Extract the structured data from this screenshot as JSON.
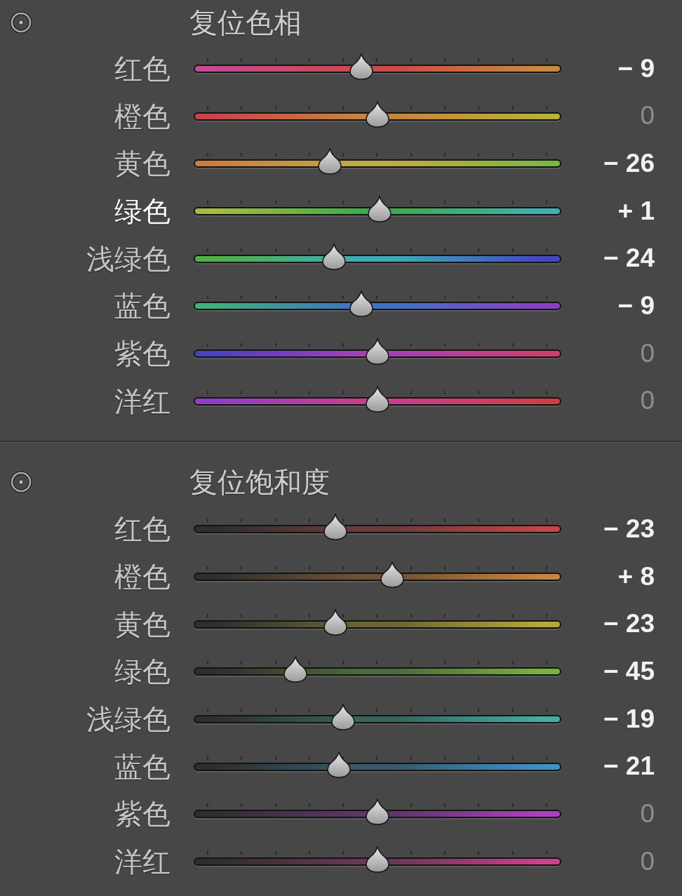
{
  "sections": [
    {
      "title": "复位色相",
      "rows": [
        {
          "label": "红色",
          "highlighted": false,
          "stops": [
            {
              "color": "#c44a92"
            },
            {
              "color": "#cc4a4a"
            },
            {
              "color": "#c98a3e"
            }
          ],
          "level": 0.455,
          "value": "− 9",
          "dimmed": false
        },
        {
          "label": "橙色",
          "highlighted": false,
          "stops": [
            {
              "color": "#c8444a"
            },
            {
              "color": "#c8843e"
            },
            {
              "color": "#b8b03c"
            }
          ],
          "level": 0.5,
          "value": "0",
          "dimmed": true
        },
        {
          "label": "黄色",
          "highlighted": false,
          "stops": [
            {
              "color": "#cc7c3e"
            },
            {
              "color": "#c0ac3e"
            },
            {
              "color": "#7cb83e"
            }
          ],
          "level": 0.37,
          "value": "− 26",
          "dimmed": false
        },
        {
          "label": "绿色",
          "highlighted": true,
          "stops": [
            {
              "color": "#a6bc3e"
            },
            {
              "color": "#3eac4a"
            },
            {
              "color": "#3eb0b4"
            }
          ],
          "level": 0.505,
          "value": "+ 1",
          "dimmed": false
        },
        {
          "label": "浅绿色",
          "highlighted": false,
          "stops": [
            {
              "color": "#52b046"
            },
            {
              "color": "#3eaab4"
            },
            {
              "color": "#4446c4"
            }
          ],
          "level": 0.38,
          "value": "− 24",
          "dimmed": false
        },
        {
          "label": "蓝色",
          "highlighted": false,
          "stops": [
            {
              "color": "#3eb07c"
            },
            {
              "color": "#3e72c4"
            },
            {
              "color": "#8a3ec8"
            }
          ],
          "level": 0.455,
          "value": "− 9",
          "dimmed": false
        },
        {
          "label": "紫色",
          "highlighted": false,
          "stops": [
            {
              "color": "#4a40c4"
            },
            {
              "color": "#a63eb8"
            },
            {
              "color": "#d03e6e"
            }
          ],
          "level": 0.5,
          "value": "0",
          "dimmed": true
        },
        {
          "label": "洋红",
          "highlighted": false,
          "stops": [
            {
              "color": "#8e3ec8"
            },
            {
              "color": "#c83e8e"
            },
            {
              "color": "#d03e44"
            }
          ],
          "level": 0.5,
          "value": "0",
          "dimmed": true
        }
      ]
    },
    {
      "title": "复位饱和度",
      "rows": [
        {
          "label": "红色",
          "highlighted": false,
          "stops": [
            {
              "color": "#2e2e2e"
            },
            {
              "color": "#6e3a3a"
            },
            {
              "color": "#c84444"
            }
          ],
          "level": 0.385,
          "value": "− 23",
          "dimmed": false
        },
        {
          "label": "橙色",
          "highlighted": false,
          "stops": [
            {
              "color": "#2e2e2e"
            },
            {
              "color": "#6e5236"
            },
            {
              "color": "#c8843e"
            }
          ],
          "level": 0.54,
          "value": "+ 8",
          "dimmed": false
        },
        {
          "label": "黄色",
          "highlighted": false,
          "stops": [
            {
              "color": "#2e2e2e"
            },
            {
              "color": "#6a6436"
            },
            {
              "color": "#b8a83c"
            }
          ],
          "level": 0.385,
          "value": "− 23",
          "dimmed": false
        },
        {
          "label": "绿色",
          "highlighted": false,
          "stops": [
            {
              "color": "#2e2e2e"
            },
            {
              "color": "#4e6a36"
            },
            {
              "color": "#78b43e"
            }
          ],
          "level": 0.275,
          "value": "− 45",
          "dimmed": false
        },
        {
          "label": "浅绿色",
          "highlighted": false,
          "stops": [
            {
              "color": "#2e2e2e"
            },
            {
              "color": "#36645e"
            },
            {
              "color": "#3eb0a0"
            }
          ],
          "level": 0.405,
          "value": "− 19",
          "dimmed": false
        },
        {
          "label": "蓝色",
          "highlighted": false,
          "stops": [
            {
              "color": "#2e2e2e"
            },
            {
              "color": "#365a6e"
            },
            {
              "color": "#3e90c8"
            }
          ],
          "level": 0.395,
          "value": "− 21",
          "dimmed": false
        },
        {
          "label": "紫色",
          "highlighted": false,
          "stops": [
            {
              "color": "#2e2e2e"
            },
            {
              "color": "#5e366a"
            },
            {
              "color": "#b03ec4"
            }
          ],
          "level": 0.5,
          "value": "0",
          "dimmed": true
        },
        {
          "label": "洋红",
          "highlighted": false,
          "stops": [
            {
              "color": "#2e2e2e"
            },
            {
              "color": "#6a3654"
            },
            {
              "color": "#d03e92"
            }
          ],
          "level": 0.5,
          "value": "0",
          "dimmed": true
        }
      ]
    }
  ]
}
